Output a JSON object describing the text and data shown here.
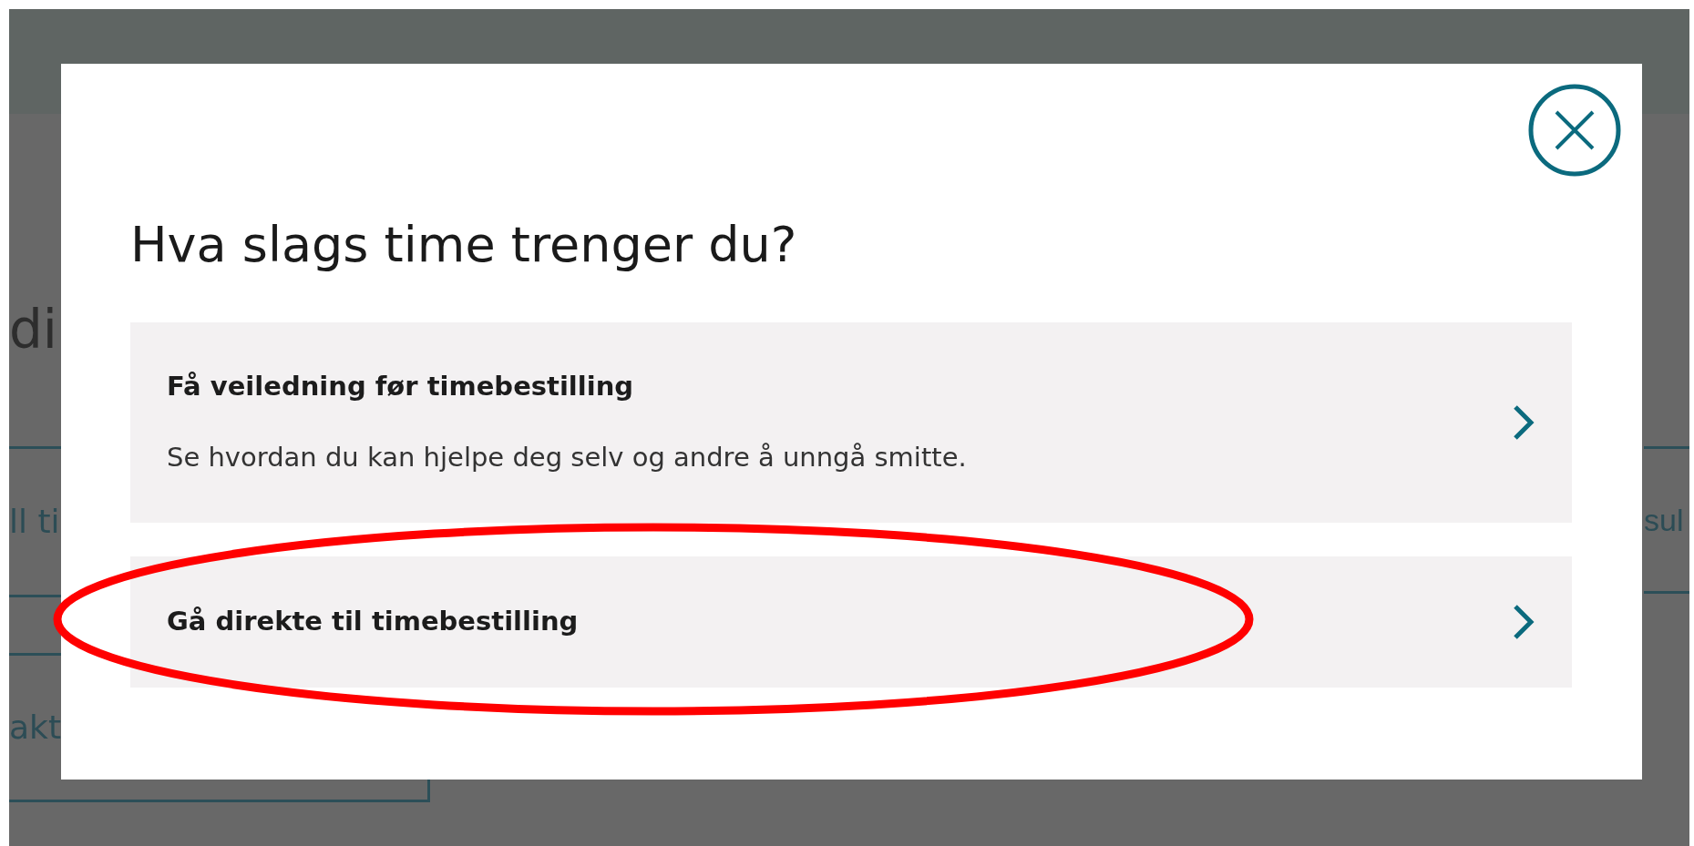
{
  "page": {
    "heading": "di",
    "left_links": [
      {
        "label": "ll ti"
      },
      {
        "label": "akt"
      }
    ],
    "right_link": "sul"
  },
  "dialog": {
    "title": "Hva slags time trenger du?",
    "options": [
      {
        "title": "Få veiledning før timebestilling",
        "description": "Se hvordan du kan hjelpe deg selv og andre å unngå smitte."
      },
      {
        "title": "Gå direkte til timebestilling"
      }
    ]
  }
}
